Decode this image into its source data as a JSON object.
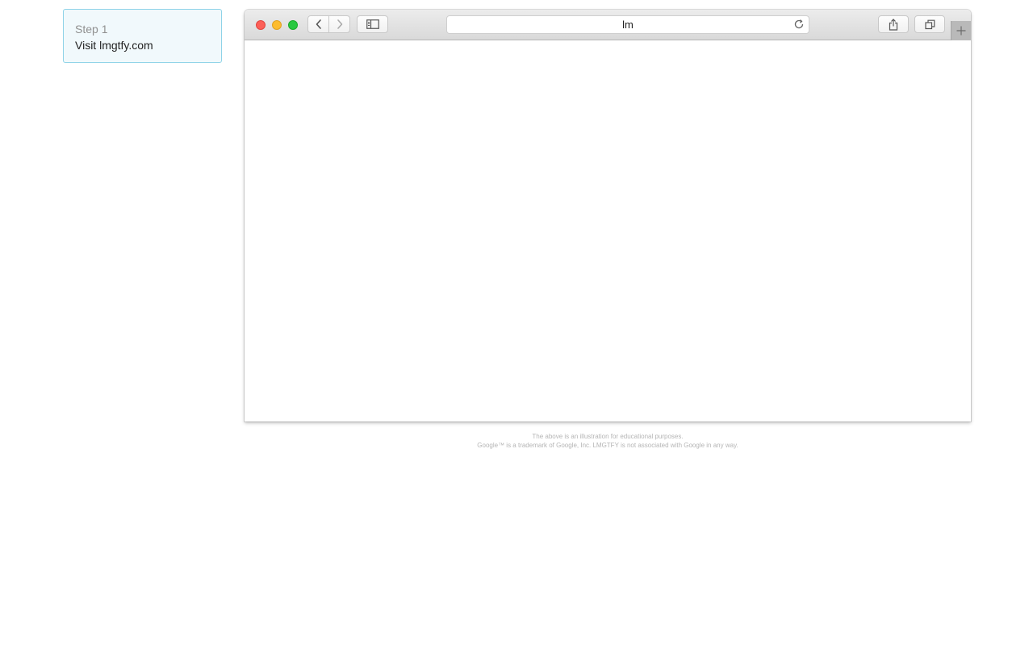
{
  "step": {
    "label": "Step 1",
    "text": "Visit lmgtfy.com"
  },
  "browser": {
    "address_text": "lm",
    "icons": {
      "close": "close-dot",
      "minimize": "minimize-dot",
      "maximize": "maximize-dot",
      "back": "chevron-left-icon",
      "forward": "chevron-right-icon",
      "sidebar": "sidebar-icon",
      "reload": "reload-icon",
      "share": "share-icon",
      "tabs": "tabs-overview-icon",
      "new_tab": "plus-icon"
    }
  },
  "footer": {
    "line1": "The above is an illustration for educational purposes.",
    "line2": "Google™ is a trademark of Google, Inc. LMGTFY is not associated with Google in any way."
  },
  "colors": {
    "card_border": "#8fd3e8",
    "card_bg": "#f1f9fc",
    "close": "#fc5f57",
    "minimize": "#fdbc2e",
    "maximize": "#28c840"
  }
}
